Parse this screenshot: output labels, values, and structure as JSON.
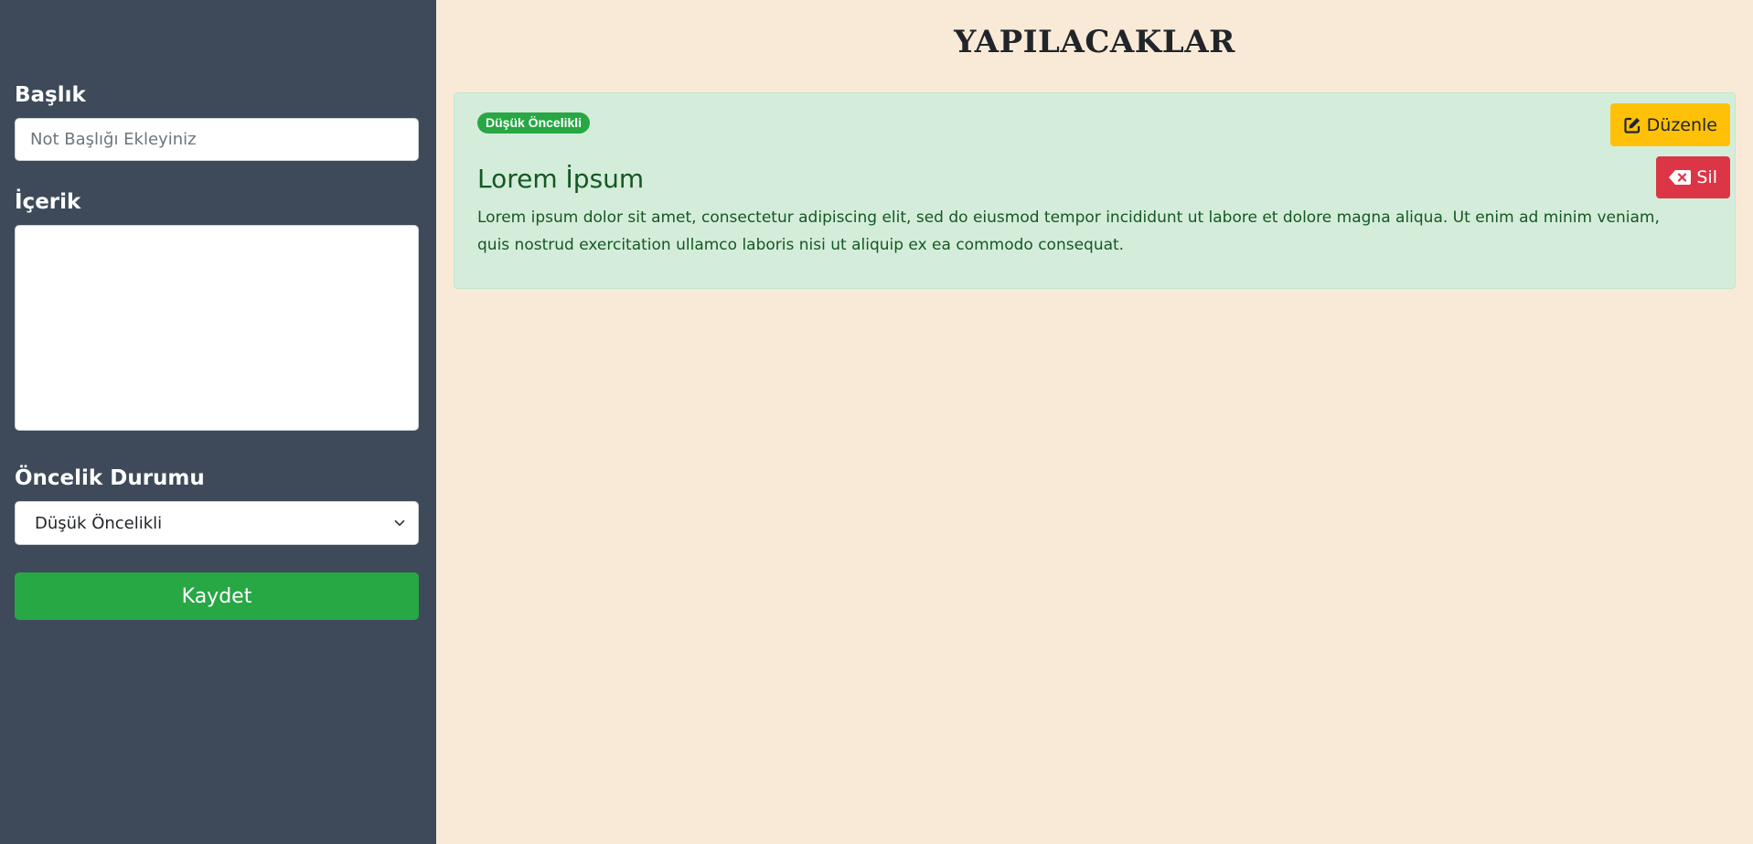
{
  "form": {
    "title_label": "Başlık",
    "title_placeholder": "Not Başlığı Ekleyiniz",
    "title_value": "",
    "content_label": "İçerik",
    "content_value": "",
    "priority_label": "Öncelik Durumu",
    "priority_selected": "Düşük Öncelikli",
    "save_label": "Kaydet"
  },
  "main": {
    "page_title": "YAPILACAKLAR",
    "notes": [
      {
        "priority_badge": "Düşük Öncelikli",
        "title": "Lorem İpsum",
        "content": "Lorem ipsum dolor sit amet, consectetur adipiscing elit, sed do eiusmod tempor incididunt ut labore et dolore magna aliqua. Ut enim ad minim veniam, quis nostrud exercitation ullamco laboris nisi ut aliquip ex ea commodo consequat.",
        "edit_label": "Düzenle",
        "delete_label": "Sil",
        "edit_icon": "edit-icon",
        "delete_icon": "backspace-icon"
      }
    ]
  },
  "colors": {
    "sidebar_bg": "#3e4a5a",
    "main_bg": "#f9ead7",
    "card_bg": "#d4edda",
    "card_text": "#155724",
    "success": "#28a745",
    "warning": "#ffc107",
    "danger": "#dc3545"
  }
}
